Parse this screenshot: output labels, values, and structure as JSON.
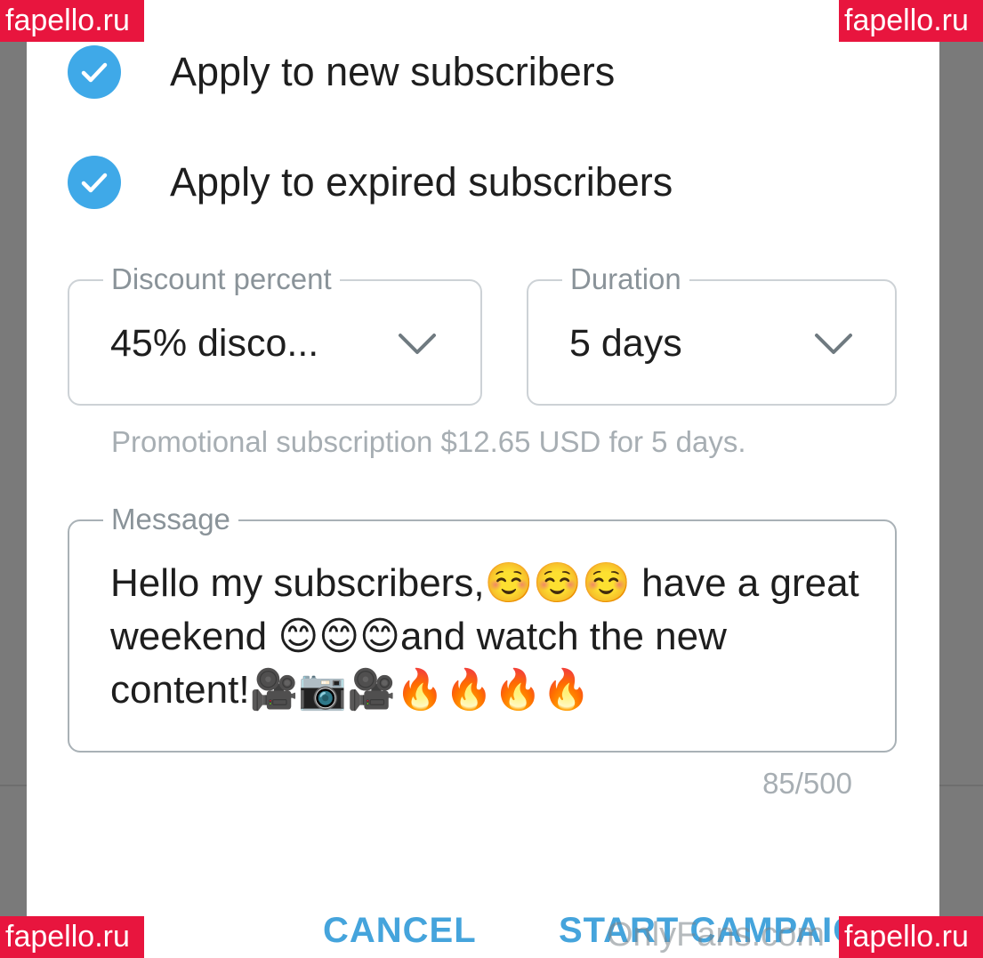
{
  "options": [
    {
      "label": "Apply to new subscribers",
      "checked": true
    },
    {
      "label": "Apply to expired subscribers",
      "checked": true
    }
  ],
  "discount": {
    "label": "Discount percent",
    "value": "45% disco..."
  },
  "duration": {
    "label": "Duration",
    "value": "5 days"
  },
  "helper_text": "Promotional subscription $12.65 USD for 5 days.",
  "message": {
    "label": "Message",
    "text": "Hello my subscribers,☺️☺️☺️ have a great weekend 😊😊😊and watch the new content!🎥📷🎥🔥🔥🔥🔥",
    "counter": "85/500"
  },
  "actions": {
    "cancel": "CANCEL",
    "start": "START CAMPAIGN"
  },
  "watermarks": {
    "site": "fapello.ru",
    "overlay": "OnlyFans.com"
  },
  "colors": {
    "accent": "#3fa9e8",
    "button_text": "#45a4dc",
    "badge": "#e8153e"
  },
  "icons": {
    "check": "check-icon",
    "dropdown": "chevron-down-icon"
  }
}
